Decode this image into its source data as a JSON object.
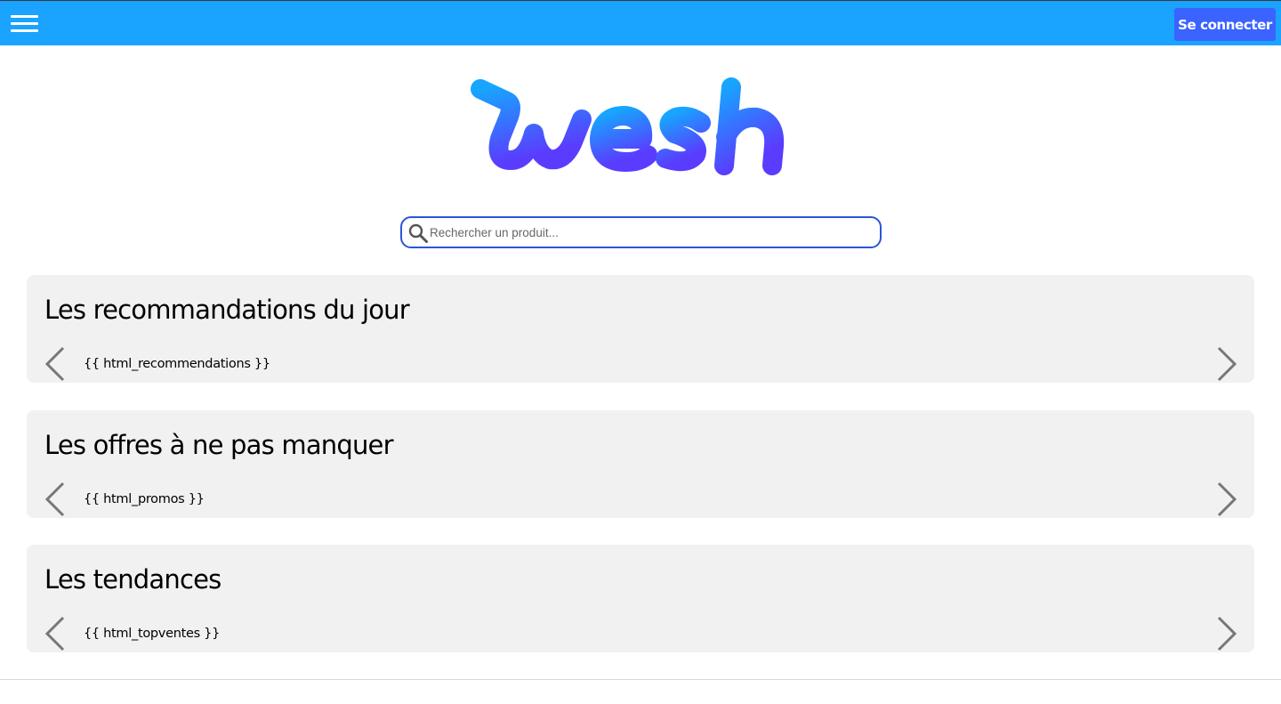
{
  "colors": {
    "topbar": "#1aa3ff",
    "login_button": "#3a63ff",
    "logo_gradient_start": "#16a6ff",
    "logo_gradient_end": "#5a3cff",
    "search_border": "#2a56d8",
    "section_bg": "#f1f1f1"
  },
  "header": {
    "menu_icon": "hamburger-icon",
    "login_label": "Se connecter"
  },
  "logo": {
    "text": "wesh"
  },
  "search": {
    "icon": "search-icon",
    "placeholder": "Rechercher un produit...",
    "value": ""
  },
  "sections": [
    {
      "title": "Les recommandations du jour",
      "content": "{{ html_recommendations }}",
      "prev_icon": "chevron-left-icon",
      "next_icon": "chevron-right-icon"
    },
    {
      "title": "Les offres à ne pas manquer",
      "content": "{{ html_promos }}",
      "prev_icon": "chevron-left-icon",
      "next_icon": "chevron-right-icon"
    },
    {
      "title": "Les tendances",
      "content": "{{ html_topventes }}",
      "prev_icon": "chevron-left-icon",
      "next_icon": "chevron-right-icon"
    }
  ]
}
